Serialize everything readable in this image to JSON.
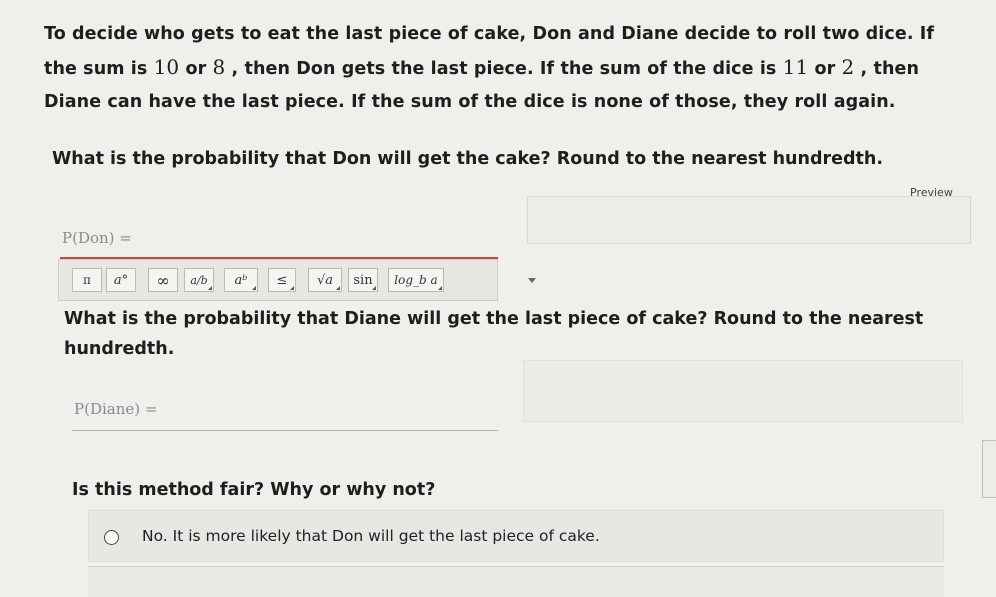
{
  "problem": {
    "line1": "To decide who gets to eat the last piece of cake, Don and Diane decide to roll two dice. If",
    "line2_a": "the sum is ",
    "line2_n1": "10",
    "line2_b": " or ",
    "line2_n2": "8",
    "line2_c": " , then Don gets the last piece. If the sum of the dice is ",
    "line2_n3": "11",
    "line2_d": " or ",
    "line2_n4": "2",
    "line2_e": " , then",
    "line3": "Diane can have the last piece. If the sum of the dice is none of those, they roll again."
  },
  "question1": {
    "text": "What is the probability that Don will get the cake? Round to the nearest hundredth.",
    "preview_label": "Preview",
    "field_label": "P(Don) =",
    "field_value": ""
  },
  "toolbar": {
    "buttons": [
      "π",
      "a°",
      "∞",
      "a/b",
      "aᵇ",
      "≤",
      "√a",
      "sin",
      "log_b a"
    ],
    "dropdown_icon": "caret-down-icon"
  },
  "question2": {
    "text": "What is the probability that Diane will get the last piece of cake? Round to the nearest hundredth.",
    "field_label": "P(Diane) =",
    "field_value": ""
  },
  "question3": {
    "text": "Is this method fair? Why or why not?",
    "choices": [
      "No. It is more likely that Don will get the last piece of cake."
    ]
  },
  "colors": {
    "background": "#efefeb",
    "active_underline": "#c8483e",
    "text": "#1e1e1e"
  }
}
